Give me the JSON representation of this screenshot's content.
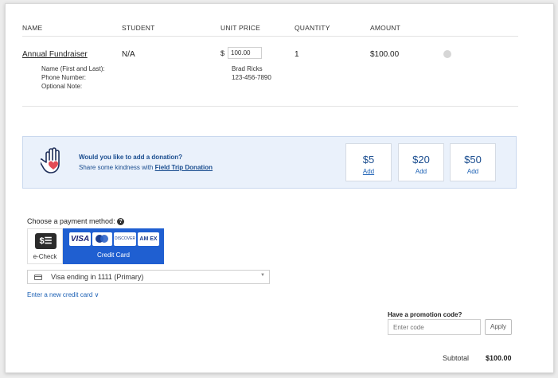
{
  "table": {
    "headers": [
      "NAME",
      "STUDENT",
      "UNIT PRICE",
      "QUANTITY",
      "AMOUNT"
    ],
    "row": {
      "name": "Annual Fundraiser",
      "student": "N/A",
      "currency": "$",
      "unit_price": "100.00",
      "quantity": "1",
      "amount": "$100.00",
      "fields": [
        "Name (First and Last):",
        "Phone Number:",
        "Optional Note:"
      ],
      "values": [
        "Brad Ricks",
        "123-456-7890"
      ]
    }
  },
  "donation": {
    "question": "Would you like to add a donation?",
    "prompt_prefix": "Share some kindness with ",
    "prompt_link": "Field Trip Donation",
    "options": [
      {
        "amount": "$5",
        "add": "Add"
      },
      {
        "amount": "$20",
        "add": "Add"
      },
      {
        "amount": "$50",
        "add": "Add"
      }
    ]
  },
  "payment": {
    "label": "Choose a payment method:",
    "echeck_label": "e-Check",
    "credit_label": "Credit Card",
    "card_brands": [
      "VISA",
      "DISCOVER",
      "AM EX"
    ],
    "selected_card": "Visa ending in 1111 (Primary)",
    "new_card_link": "Enter a new credit card"
  },
  "promo": {
    "label": "Have a promotion code?",
    "placeholder": "Enter code",
    "apply": "Apply"
  },
  "summary": {
    "subtotal_label": "Subtotal",
    "subtotal_value": "$100.00"
  },
  "colors": {
    "accent": "#1a5fb4",
    "credit_card_bg": "#1f5fd1",
    "donation_bg": "#eaf1fb",
    "heart": "#e24b55"
  }
}
